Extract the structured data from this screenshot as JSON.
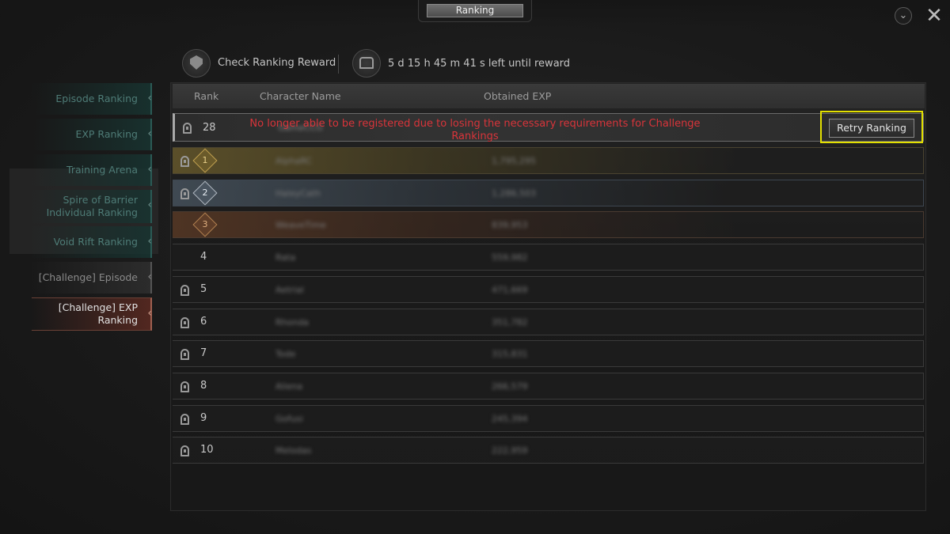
{
  "header": {
    "title": "Ranking",
    "sort_icon": "chevron-down-circle-icon",
    "close_icon": "close-icon"
  },
  "reward": {
    "check_label": "Check Ranking Reward",
    "timer_text": "5 d 15 h 45 m 41 s left until reward"
  },
  "sidebar": {
    "items": [
      {
        "label": "Episode Ranking"
      },
      {
        "label": "EXP Ranking"
      },
      {
        "label": "Training Arena"
      },
      {
        "label": "Spire of Barrier Individual Ranking"
      },
      {
        "label": "Void Rift Ranking"
      },
      {
        "label": "[Challenge] Episode"
      },
      {
        "label": "[Challenge] EXP Ranking"
      }
    ],
    "active_index": 6
  },
  "table": {
    "columns": [
      "Rank",
      "Character Name",
      "Obtained EXP"
    ],
    "my_row": {
      "rank": "28",
      "name": "GameCCG",
      "exp": ""
    },
    "warning": "No longer able to be registered due to losing the necessary requirements for Challenge Rankings",
    "retry_label": "Retry Ranking",
    "rows": [
      {
        "rank": "1",
        "name": "AlphaRC",
        "exp": "1,795,295"
      },
      {
        "rank": "2",
        "name": "HaleyCath",
        "exp": "1,286,503"
      },
      {
        "rank": "3",
        "name": "WeaveTime",
        "exp": "839,953"
      },
      {
        "rank": "4",
        "name": "Rata",
        "exp": "559,982"
      },
      {
        "rank": "5",
        "name": "Aetrial",
        "exp": "471,669"
      },
      {
        "rank": "6",
        "name": "Rhonda",
        "exp": "351,782"
      },
      {
        "rank": "7",
        "name": "Tode",
        "exp": "315,831"
      },
      {
        "rank": "8",
        "name": "Aliena",
        "exp": "266,579"
      },
      {
        "rank": "9",
        "name": "Gofusi",
        "exp": "245,394"
      },
      {
        "rank": "10",
        "name": "Melodas",
        "exp": "222,959"
      }
    ]
  },
  "colors": {
    "warning": "#d9343a",
    "highlight": "#e3e000",
    "active_tab": "#552820",
    "inactive_tab": "#173431"
  }
}
